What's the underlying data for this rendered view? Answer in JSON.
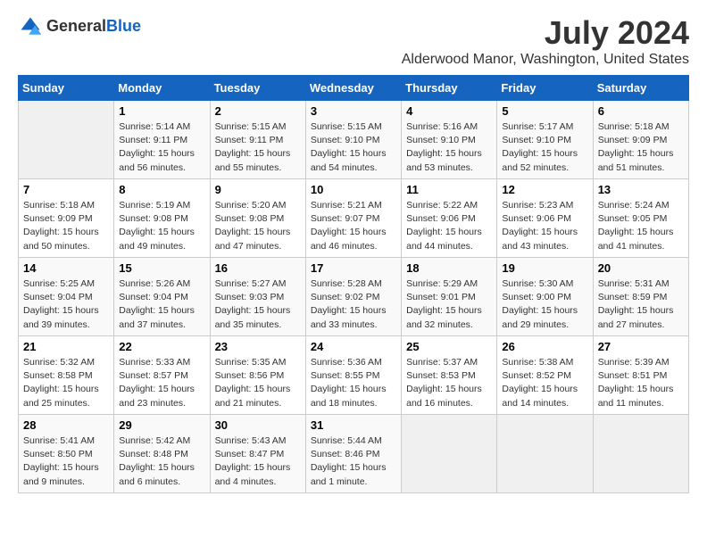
{
  "header": {
    "logo_general": "General",
    "logo_blue": "Blue",
    "month_year": "July 2024",
    "location": "Alderwood Manor, Washington, United States"
  },
  "days_of_week": [
    "Sunday",
    "Monday",
    "Tuesday",
    "Wednesday",
    "Thursday",
    "Friday",
    "Saturday"
  ],
  "weeks": [
    [
      {
        "day": "",
        "sunrise": "",
        "sunset": "",
        "daylight": ""
      },
      {
        "day": "1",
        "sunrise": "Sunrise: 5:14 AM",
        "sunset": "Sunset: 9:11 PM",
        "daylight": "Daylight: 15 hours and 56 minutes."
      },
      {
        "day": "2",
        "sunrise": "Sunrise: 5:15 AM",
        "sunset": "Sunset: 9:11 PM",
        "daylight": "Daylight: 15 hours and 55 minutes."
      },
      {
        "day": "3",
        "sunrise": "Sunrise: 5:15 AM",
        "sunset": "Sunset: 9:10 PM",
        "daylight": "Daylight: 15 hours and 54 minutes."
      },
      {
        "day": "4",
        "sunrise": "Sunrise: 5:16 AM",
        "sunset": "Sunset: 9:10 PM",
        "daylight": "Daylight: 15 hours and 53 minutes."
      },
      {
        "day": "5",
        "sunrise": "Sunrise: 5:17 AM",
        "sunset": "Sunset: 9:10 PM",
        "daylight": "Daylight: 15 hours and 52 minutes."
      },
      {
        "day": "6",
        "sunrise": "Sunrise: 5:18 AM",
        "sunset": "Sunset: 9:09 PM",
        "daylight": "Daylight: 15 hours and 51 minutes."
      }
    ],
    [
      {
        "day": "7",
        "sunrise": "Sunrise: 5:18 AM",
        "sunset": "Sunset: 9:09 PM",
        "daylight": "Daylight: 15 hours and 50 minutes."
      },
      {
        "day": "8",
        "sunrise": "Sunrise: 5:19 AM",
        "sunset": "Sunset: 9:08 PM",
        "daylight": "Daylight: 15 hours and 49 minutes."
      },
      {
        "day": "9",
        "sunrise": "Sunrise: 5:20 AM",
        "sunset": "Sunset: 9:08 PM",
        "daylight": "Daylight: 15 hours and 47 minutes."
      },
      {
        "day": "10",
        "sunrise": "Sunrise: 5:21 AM",
        "sunset": "Sunset: 9:07 PM",
        "daylight": "Daylight: 15 hours and 46 minutes."
      },
      {
        "day": "11",
        "sunrise": "Sunrise: 5:22 AM",
        "sunset": "Sunset: 9:06 PM",
        "daylight": "Daylight: 15 hours and 44 minutes."
      },
      {
        "day": "12",
        "sunrise": "Sunrise: 5:23 AM",
        "sunset": "Sunset: 9:06 PM",
        "daylight": "Daylight: 15 hours and 43 minutes."
      },
      {
        "day": "13",
        "sunrise": "Sunrise: 5:24 AM",
        "sunset": "Sunset: 9:05 PM",
        "daylight": "Daylight: 15 hours and 41 minutes."
      }
    ],
    [
      {
        "day": "14",
        "sunrise": "Sunrise: 5:25 AM",
        "sunset": "Sunset: 9:04 PM",
        "daylight": "Daylight: 15 hours and 39 minutes."
      },
      {
        "day": "15",
        "sunrise": "Sunrise: 5:26 AM",
        "sunset": "Sunset: 9:04 PM",
        "daylight": "Daylight: 15 hours and 37 minutes."
      },
      {
        "day": "16",
        "sunrise": "Sunrise: 5:27 AM",
        "sunset": "Sunset: 9:03 PM",
        "daylight": "Daylight: 15 hours and 35 minutes."
      },
      {
        "day": "17",
        "sunrise": "Sunrise: 5:28 AM",
        "sunset": "Sunset: 9:02 PM",
        "daylight": "Daylight: 15 hours and 33 minutes."
      },
      {
        "day": "18",
        "sunrise": "Sunrise: 5:29 AM",
        "sunset": "Sunset: 9:01 PM",
        "daylight": "Daylight: 15 hours and 32 minutes."
      },
      {
        "day": "19",
        "sunrise": "Sunrise: 5:30 AM",
        "sunset": "Sunset: 9:00 PM",
        "daylight": "Daylight: 15 hours and 29 minutes."
      },
      {
        "day": "20",
        "sunrise": "Sunrise: 5:31 AM",
        "sunset": "Sunset: 8:59 PM",
        "daylight": "Daylight: 15 hours and 27 minutes."
      }
    ],
    [
      {
        "day": "21",
        "sunrise": "Sunrise: 5:32 AM",
        "sunset": "Sunset: 8:58 PM",
        "daylight": "Daylight: 15 hours and 25 minutes."
      },
      {
        "day": "22",
        "sunrise": "Sunrise: 5:33 AM",
        "sunset": "Sunset: 8:57 PM",
        "daylight": "Daylight: 15 hours and 23 minutes."
      },
      {
        "day": "23",
        "sunrise": "Sunrise: 5:35 AM",
        "sunset": "Sunset: 8:56 PM",
        "daylight": "Daylight: 15 hours and 21 minutes."
      },
      {
        "day": "24",
        "sunrise": "Sunrise: 5:36 AM",
        "sunset": "Sunset: 8:55 PM",
        "daylight": "Daylight: 15 hours and 18 minutes."
      },
      {
        "day": "25",
        "sunrise": "Sunrise: 5:37 AM",
        "sunset": "Sunset: 8:53 PM",
        "daylight": "Daylight: 15 hours and 16 minutes."
      },
      {
        "day": "26",
        "sunrise": "Sunrise: 5:38 AM",
        "sunset": "Sunset: 8:52 PM",
        "daylight": "Daylight: 15 hours and 14 minutes."
      },
      {
        "day": "27",
        "sunrise": "Sunrise: 5:39 AM",
        "sunset": "Sunset: 8:51 PM",
        "daylight": "Daylight: 15 hours and 11 minutes."
      }
    ],
    [
      {
        "day": "28",
        "sunrise": "Sunrise: 5:41 AM",
        "sunset": "Sunset: 8:50 PM",
        "daylight": "Daylight: 15 hours and 9 minutes."
      },
      {
        "day": "29",
        "sunrise": "Sunrise: 5:42 AM",
        "sunset": "Sunset: 8:48 PM",
        "daylight": "Daylight: 15 hours and 6 minutes."
      },
      {
        "day": "30",
        "sunrise": "Sunrise: 5:43 AM",
        "sunset": "Sunset: 8:47 PM",
        "daylight": "Daylight: 15 hours and 4 minutes."
      },
      {
        "day": "31",
        "sunrise": "Sunrise: 5:44 AM",
        "sunset": "Sunset: 8:46 PM",
        "daylight": "Daylight: 15 hours and 1 minute."
      },
      {
        "day": "",
        "sunrise": "",
        "sunset": "",
        "daylight": ""
      },
      {
        "day": "",
        "sunrise": "",
        "sunset": "",
        "daylight": ""
      },
      {
        "day": "",
        "sunrise": "",
        "sunset": "",
        "daylight": ""
      }
    ]
  ]
}
